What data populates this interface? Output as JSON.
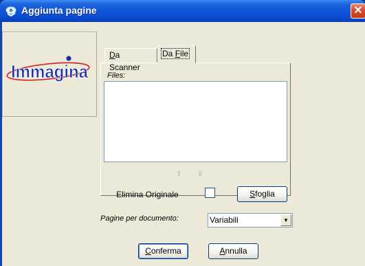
{
  "window": {
    "title": "Aggiunta pagine",
    "close_label": "✕"
  },
  "logo": {
    "text": "Immagina"
  },
  "tabs": [
    {
      "label_u": "D",
      "label_rest": "a Scanner"
    },
    {
      "label_u": "Da ",
      "label_u2": "F",
      "label_rest": "ile"
    }
  ],
  "files": {
    "label": "Files:",
    "arrows": "⇧ ⇩"
  },
  "options": {
    "elimina_label": "Elimina Originale",
    "elimina_checked": false,
    "sfoglia_u": "S",
    "sfoglia_rest": "foglia"
  },
  "pagine": {
    "label": "Pagine per documento:",
    "selected": "Variabili"
  },
  "buttons": {
    "conferma_u": "C",
    "conferma_rest": "onferma",
    "annulla_u": "A",
    "annulla_rest": "nnulla"
  },
  "colors": {
    "titlebar": "#0a4bd0",
    "face": "#ece9d8",
    "close": "#d9482a",
    "logo_blue": "#1a2fa8",
    "logo_red": "#d42020"
  }
}
